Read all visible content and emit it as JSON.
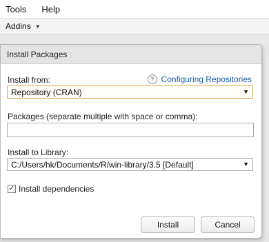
{
  "menubar": {
    "items": [
      "Tools",
      "Help"
    ]
  },
  "toolbar": {
    "addins_label": "Addins"
  },
  "dialog": {
    "title": "Install Packages",
    "install_from_label": "Install from:",
    "help_icon": "question-icon",
    "help_link": "Configuring Repositories",
    "install_from_value": "Repository (CRAN)",
    "packages_label": "Packages (separate multiple with space or comma):",
    "packages_value": "",
    "library_label": "Install to Library:",
    "library_value": "C:/Users/hk/Documents/R/win-library/3.5 [Default]",
    "dependencies_label": "Install dependencies",
    "dependencies_checked": true,
    "install_button": "Install",
    "cancel_button": "Cancel"
  },
  "colors": {
    "link": "#1f5fa8",
    "focus_border": "#d9a84a",
    "title_bar": "#e4e4e4"
  }
}
